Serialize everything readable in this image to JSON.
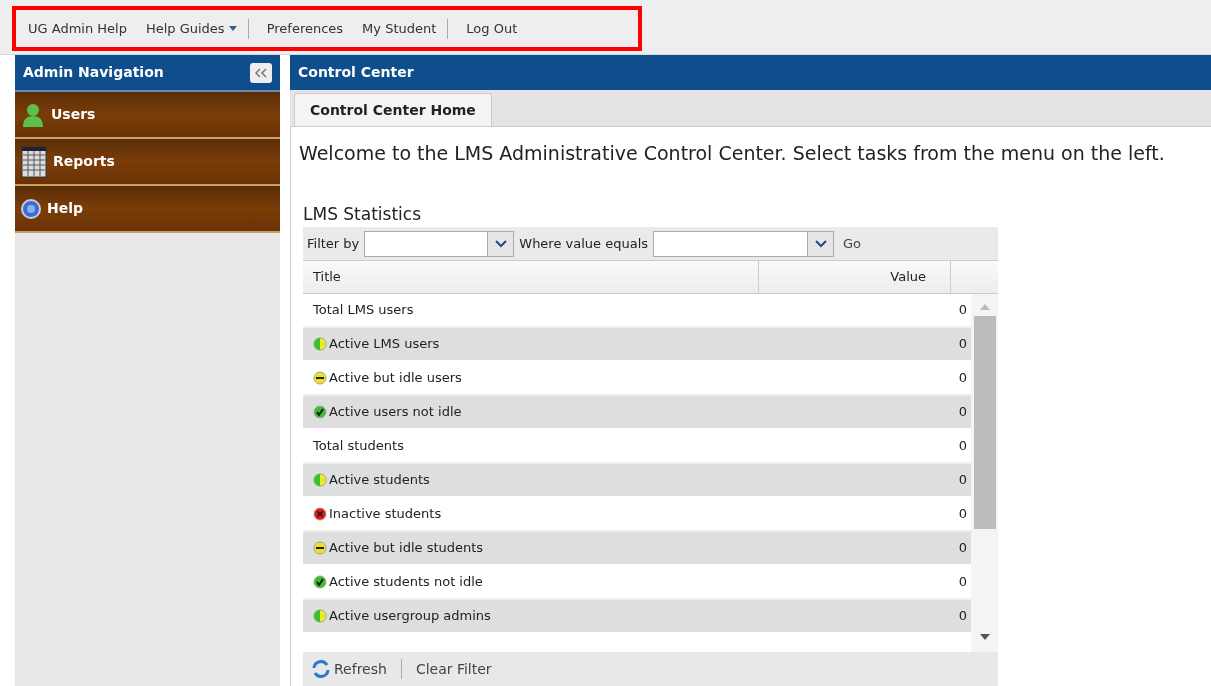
{
  "top_menu": [
    {
      "label": "UG Admin Help",
      "dropdown": false,
      "separator_after": false
    },
    {
      "label": "Help Guides",
      "dropdown": true,
      "separator_after": true
    },
    {
      "label": "Preferences",
      "dropdown": false,
      "separator_after": false
    },
    {
      "label": "My Student",
      "dropdown": false,
      "separator_after": true
    },
    {
      "label": "Log Out",
      "dropdown": false,
      "separator_after": false
    }
  ],
  "sidebar": {
    "title": "Admin Navigation",
    "items": [
      {
        "label": "Users",
        "kind": "users"
      },
      {
        "label": "Reports",
        "kind": "reports"
      },
      {
        "label": "Help",
        "kind": "help"
      }
    ]
  },
  "main": {
    "title": "Control Center",
    "tabs": [
      {
        "label": "Control Center Home",
        "selected": true
      }
    ],
    "welcome": "Welcome to the LMS Administrative Control Center. Select tasks from the menu on the left.",
    "section_title": "LMS Statistics",
    "filter": {
      "filter_label": "Filter by",
      "value_label": "Where value equals",
      "go": "Go"
    },
    "table": {
      "columns": [
        "Title",
        "Value"
      ],
      "rows": [
        {
          "title": "Total LMS users",
          "value": "0",
          "kind": "plain"
        },
        {
          "title": "Active LMS users",
          "value": "0",
          "kind": "active"
        },
        {
          "title": "Active but idle users",
          "value": "0",
          "kind": "idle"
        },
        {
          "title": "Active users not idle",
          "value": "0",
          "kind": "ok"
        },
        {
          "title": "Total students",
          "value": "0",
          "kind": "plain"
        },
        {
          "title": "Active students",
          "value": "0",
          "kind": "active"
        },
        {
          "title": "Inactive students",
          "value": "0",
          "kind": "inactive"
        },
        {
          "title": "Active but idle students",
          "value": "0",
          "kind": "idle"
        },
        {
          "title": "Active students not idle",
          "value": "0",
          "kind": "ok"
        },
        {
          "title": "Active usergroup admins",
          "value": "0",
          "kind": "active"
        }
      ]
    },
    "footer": [
      "Refresh",
      "Clear Filter"
    ]
  }
}
